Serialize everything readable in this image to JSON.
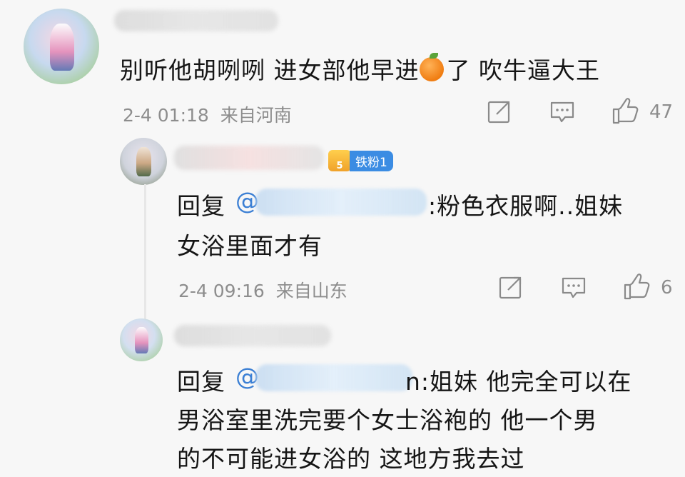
{
  "comments": [
    {
      "text_before": "别听他胡咧咧 进女部他早进",
      "emoji_icon": "orange-emoji",
      "text_after": "了 吹牛逼大王",
      "time": "2-4 01:18",
      "location": "来自河南",
      "likes": "47"
    }
  ],
  "replies": [
    {
      "badge": "铁粉1",
      "badge_level": "5",
      "reply_prefix": "回复",
      "at": "@",
      "text_line1": ":粉色衣服啊..姐妹",
      "text_line2": "女浴里面才有",
      "time": "2-4 09:16",
      "location": "来自山东",
      "likes": "6"
    },
    {
      "reply_prefix": "回复",
      "at": "@",
      "text_line1_suffix": "n:姐妹 他完全可以在",
      "text_line2": "男浴室里洗完要个女士浴袍的 他一个男",
      "text_line3": "的不可能进女浴的 这地方我去过"
    }
  ],
  "icons": {
    "share": "share-icon",
    "comment": "comment-icon",
    "like": "thumbs-up-icon"
  }
}
